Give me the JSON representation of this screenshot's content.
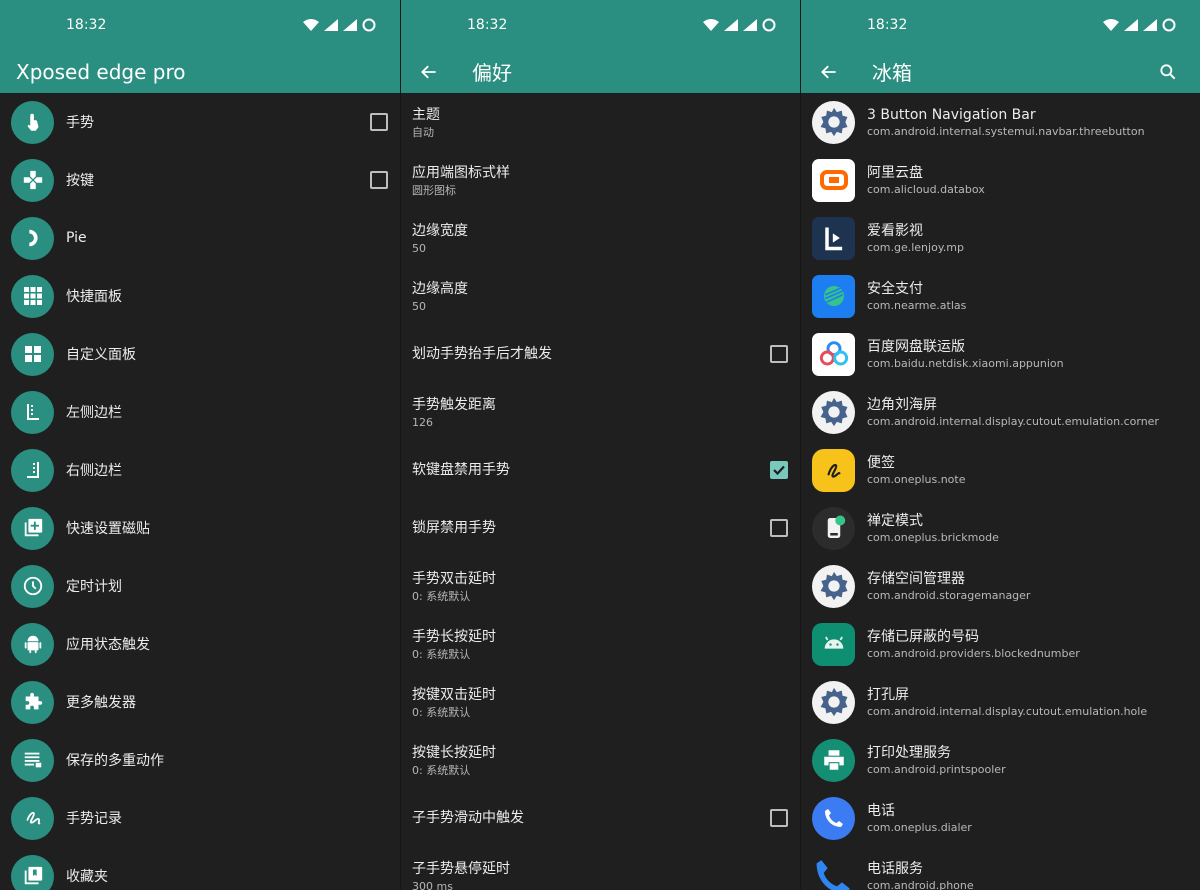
{
  "status_time": "18:32",
  "colors": {
    "accent": "#2a8f80",
    "background": "#1f1f1f",
    "check_on": "#78c9bb"
  },
  "screen1": {
    "title": "Xposed edge pro",
    "items": [
      {
        "label": "手势",
        "icon": "touch-gesture-icon",
        "checkbox": true,
        "checked": false
      },
      {
        "label": "按键",
        "icon": "gamepad-icon",
        "checkbox": true,
        "checked": false
      },
      {
        "label": "Pie",
        "icon": "pie-arc-icon"
      },
      {
        "label": "快捷面板",
        "icon": "grid-nine-icon"
      },
      {
        "label": "自定义面板",
        "icon": "grid-four-icon"
      },
      {
        "label": "左侧边栏",
        "icon": "left-sidebar-icon"
      },
      {
        "label": "右侧边栏",
        "icon": "right-sidebar-icon"
      },
      {
        "label": "快速设置磁贴",
        "icon": "add-tile-icon"
      },
      {
        "label": "定时计划",
        "icon": "clock-icon"
      },
      {
        "label": "应用状态触发",
        "icon": "android-icon"
      },
      {
        "label": "更多触发器",
        "icon": "puzzle-icon"
      },
      {
        "label": "保存的多重动作",
        "icon": "list-icon"
      },
      {
        "label": "手势记录",
        "icon": "gesture-record-icon"
      },
      {
        "label": "收藏夹",
        "icon": "collection-icon"
      }
    ]
  },
  "screen2": {
    "title": "偏好",
    "items": [
      {
        "title": "主题",
        "sub": "自动"
      },
      {
        "title": "应用端图标式样",
        "sub": "圆形图标"
      },
      {
        "title": "边缘宽度",
        "sub": "50"
      },
      {
        "title": "边缘高度",
        "sub": "50"
      },
      {
        "title": "划动手势抬手后才触发",
        "checkbox": true,
        "checked": false
      },
      {
        "title": "手势触发距离",
        "sub": "126"
      },
      {
        "title": "软键盘禁用手势",
        "checkbox": true,
        "checked": true
      },
      {
        "title": "锁屏禁用手势",
        "checkbox": true,
        "checked": false
      },
      {
        "title": "手势双击延时",
        "sub": "0: 系统默认"
      },
      {
        "title": "手势长按延时",
        "sub": "0: 系统默认"
      },
      {
        "title": "按键双击延时",
        "sub": "0: 系统默认"
      },
      {
        "title": "按键长按延时",
        "sub": "0: 系统默认"
      },
      {
        "title": "子手势滑动中触发",
        "checkbox": true,
        "checked": false
      },
      {
        "title": "子手势悬停延时",
        "sub": "300 ms"
      }
    ]
  },
  "screen3": {
    "title": "冰箱",
    "apps": [
      {
        "name": "3 Button Navigation Bar",
        "pkg": "com.android.internal.systemui.navbar.threebutton",
        "icon": "gear-app-icon"
      },
      {
        "name": "阿里云盘",
        "pkg": "com.alicloud.databox",
        "icon": "alicloud-icon"
      },
      {
        "name": "爱看影视",
        "pkg": "com.ge.lenjoy.mp",
        "icon": "aikan-icon"
      },
      {
        "name": "安全支付",
        "pkg": "com.nearme.atlas",
        "icon": "secure-pay-icon"
      },
      {
        "name": "百度网盘联运版",
        "pkg": "com.baidu.netdisk.xiaomi.appunion",
        "icon": "baidu-netdisk-icon"
      },
      {
        "name": "边角刘海屏",
        "pkg": "com.android.internal.display.cutout.emulation.corner",
        "icon": "gear-app-icon"
      },
      {
        "name": "便签",
        "pkg": "com.oneplus.note",
        "icon": "note-icon"
      },
      {
        "name": "禅定模式",
        "pkg": "com.oneplus.brickmode",
        "icon": "zen-mode-icon"
      },
      {
        "name": "存储空间管理器",
        "pkg": "com.android.storagemanager",
        "icon": "gear-app-icon"
      },
      {
        "name": "存储已屏蔽的号码",
        "pkg": "com.android.providers.blockednumber",
        "icon": "android-app-icon"
      },
      {
        "name": "打孔屏",
        "pkg": "com.android.internal.display.cutout.emulation.hole",
        "icon": "gear-app-icon"
      },
      {
        "name": "打印处理服务",
        "pkg": "com.android.printspooler",
        "icon": "printer-icon"
      },
      {
        "name": "电话",
        "pkg": "com.oneplus.dialer",
        "icon": "phone-icon"
      },
      {
        "name": "电话服务",
        "pkg": "com.android.phone",
        "icon": "phone-service-icon"
      }
    ]
  }
}
